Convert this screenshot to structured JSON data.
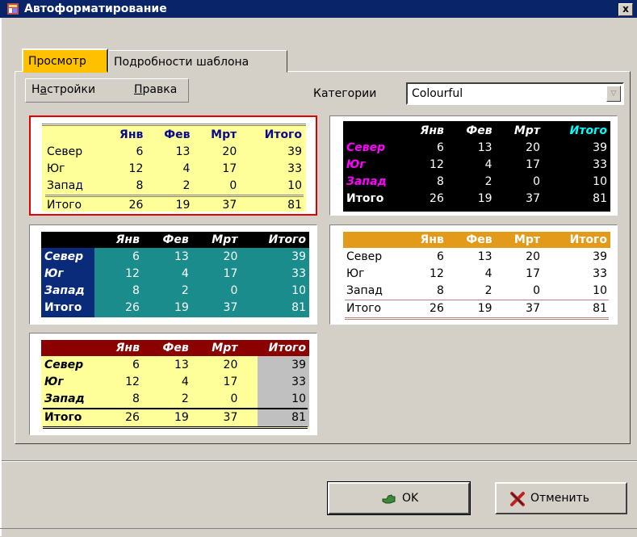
{
  "window": {
    "title": "Автоформатирование",
    "close_label": "x"
  },
  "tabs": [
    {
      "label": "Просмотр",
      "active": true
    },
    {
      "label": "Подробности шаблона",
      "active": false
    }
  ],
  "menu": {
    "settings": {
      "pre": "Н",
      "ul": "а",
      "post": "стройки"
    },
    "edit": {
      "ul": "П",
      "post": "равка"
    }
  },
  "category": {
    "label": "Категории",
    "value": "Colourful"
  },
  "sample": {
    "headers": [
      "Янв",
      "Фев",
      "Мрт",
      "Итого"
    ],
    "rows": [
      {
        "label": "Север",
        "values": [
          "6",
          "13",
          "20",
          "39"
        ]
      },
      {
        "label": "Юг",
        "values": [
          "12",
          "4",
          "17",
          "33"
        ]
      },
      {
        "label": "Запад",
        "values": [
          "8",
          "2",
          "0",
          "10"
        ]
      },
      {
        "label": "Итого",
        "values": [
          "26",
          "19",
          "37",
          "81"
        ]
      }
    ]
  },
  "buttons": {
    "ok": "OK",
    "cancel": "Отменить"
  },
  "colors": {
    "titlebar": "#0a246a",
    "active_tab": "#ffc000",
    "selection": "#e00000"
  }
}
